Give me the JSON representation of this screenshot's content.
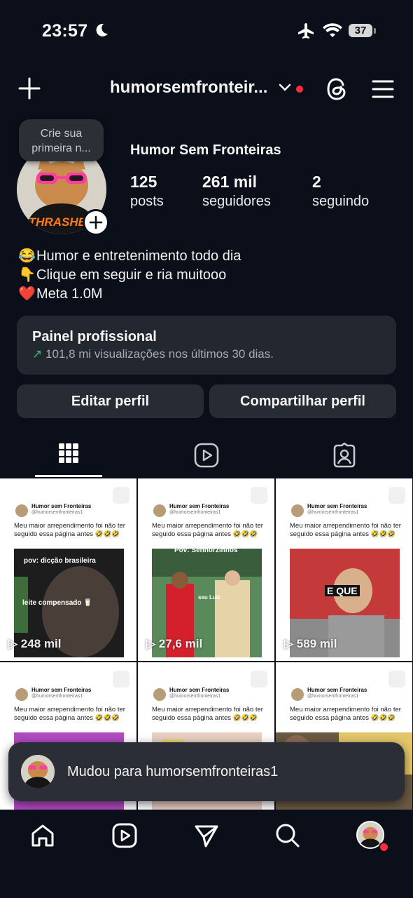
{
  "status_bar": {
    "time": "23:57",
    "battery": "37"
  },
  "header": {
    "username": "humorsemfronteir..."
  },
  "profile": {
    "tooltip": "Crie sua primeira n...",
    "display_name": "Humor Sem Fronteiras",
    "stats": [
      {
        "value": "125",
        "label": "posts"
      },
      {
        "value": "261 mil",
        "label": "seguidores"
      },
      {
        "value": "2",
        "label": "seguindo"
      }
    ],
    "bio": [
      {
        "emoji": "😂",
        "text": "Humor e entretenimento todo dia"
      },
      {
        "emoji": "👇",
        "text": "Clique em seguir e ria muitooo"
      },
      {
        "emoji": "❤️",
        "text": "Meta 1.0M"
      }
    ]
  },
  "dashboard": {
    "title": "Painel profissional",
    "subtitle": "101,8 mi visualizações nos últimos 30 dias."
  },
  "actions": {
    "edit": "Editar perfil",
    "share": "Compartilhar perfil"
  },
  "posts": [
    {
      "name": "Humor sem Fronteiras",
      "handle": "@humorsemfronteiras1",
      "caption": "Meu maior arrependimento foi não ter seguido essa página antes 🤣🤣🤣",
      "overlay1": "pov: dicção brasileira",
      "overlay2": "leite compensado 🥛",
      "views": "248 mil"
    },
    {
      "name": "Humor sem Fronteiras",
      "handle": "@humorsemfronteiras1",
      "caption": "Meu maior arrependimento foi não ter seguido essa página antes 🤣🤣🤣",
      "overlay1": "Pov: Senhorzinhos",
      "overlay2": "seu Luiz",
      "views": "27,6 mil"
    },
    {
      "name": "Humor sem Fronteiras",
      "handle": "@humorsemfronteiras1",
      "caption": "Meu maior arrependimento foi não ter seguido essa página antes 🤣🤣🤣",
      "overlay1": "E QUE",
      "overlay2": "",
      "views": "589 mil"
    },
    {
      "name": "Humor sem Fronteiras",
      "handle": "@humorsemfronteiras1",
      "caption": "Meu maior arrependimento foi não ter seguido essa página antes 🤣🤣🤣",
      "overlay1": "",
      "overlay2": "",
      "views": ""
    },
    {
      "name": "Humor sem Fronteiras",
      "handle": "@humorsemfronteiras1",
      "caption": "Meu maior arrependimento foi não ter seguido essa página antes 🤣🤣🤣",
      "overlay1": "",
      "overlay2": "",
      "views": ""
    },
    {
      "name": "Humor sem Fronteiras",
      "handle": "@humorsemfronteiras1",
      "caption": "Meu maior arrependimento foi não ter seguido essa página antes 🤣🤣🤣",
      "overlay1": "",
      "overlay2": "",
      "views": ""
    }
  ],
  "toast": {
    "text": "Mudou para humorsemfronteiras1"
  },
  "colors": {
    "background": "#0b0f19",
    "notification": "#ff2d3b",
    "trend": "#38c172"
  }
}
